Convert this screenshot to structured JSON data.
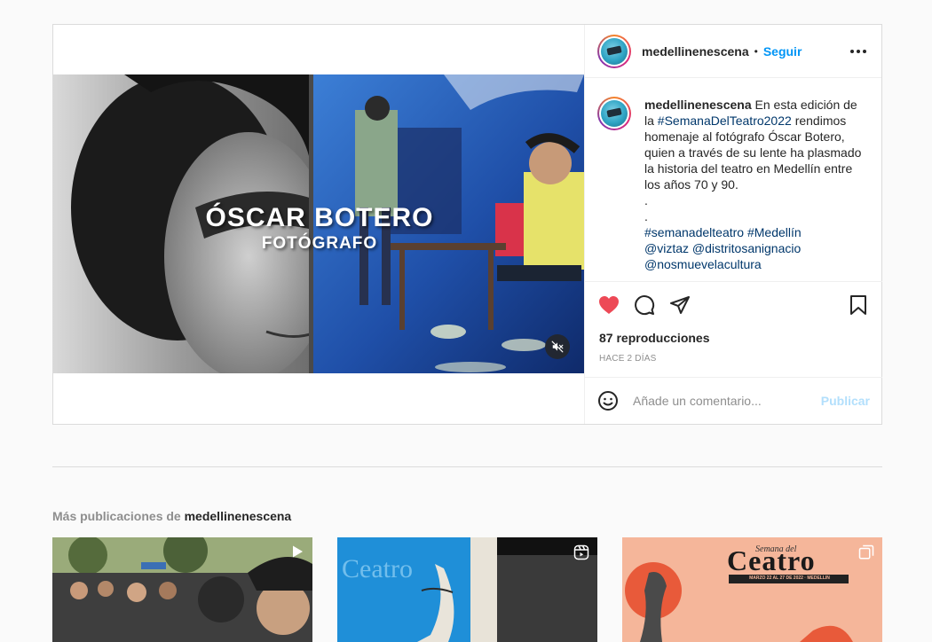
{
  "post": {
    "video_title_line1": "ÓSCAR BOTERO",
    "video_title_line2": "FOTÓGRAFO",
    "mute_icon": "speaker-muted-icon"
  },
  "header": {
    "username": "medellinenescena",
    "separator": "•",
    "follow_label": "Seguir",
    "more_icon": "more-horizontal-icon"
  },
  "caption": {
    "username": "medellinenescena",
    "text_before_tag": "En esta edición de la",
    "hashtag_1": "#SemanaDelTeatro2022",
    "text_after_tag": "rendimos homenaje al fotógrafo Óscar Botero, quien a través de su lente ha plasmado la historia del teatro en Medellín entre los años 70 y 90.",
    "dot_1": ".",
    "dot_2": ".",
    "hashtag_2": "#semanadelteatro",
    "hashtag_3": "#Medellín",
    "mention_1": "@viztaz",
    "mention_2": "@distritosanignacio",
    "mention_3": "@nosmuevelacultura"
  },
  "actions": {
    "like_icon": "heart-filled-icon",
    "comment_icon": "comment-icon",
    "share_icon": "paper-plane-icon",
    "save_icon": "bookmark-icon",
    "views": "87 reproducciones",
    "timestamp": "HACE 2 DÍAS"
  },
  "comment": {
    "emoji_icon": "emoji-icon",
    "placeholder": "Añade un comentario...",
    "publish_label": "Publicar"
  },
  "more_posts": {
    "prefix": "Más publicaciones de",
    "username": "medellinenescena",
    "items": [
      {
        "type_icon": "video-play-icon"
      },
      {
        "type_icon": "reels-icon"
      },
      {
        "type_icon": "carousel-icon",
        "poster_title_small": "Semana del",
        "poster_title": "Ceatro",
        "poster_dates": "MARZO 22 AL 27 DE 2022 · MEDELLÍN"
      }
    ]
  },
  "colors": {
    "accent": "#0095f6",
    "like": "#ed4956",
    "publish_disabled": "#b2dffc",
    "tag": "#00376b"
  }
}
